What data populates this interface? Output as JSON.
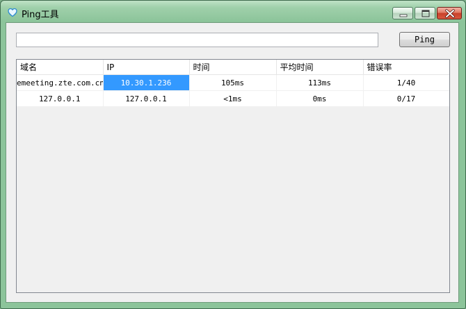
{
  "window": {
    "title": "Ping工具"
  },
  "controls": {
    "host_input_value": "",
    "ping_button_label": "Ping"
  },
  "table": {
    "headers": [
      "域名",
      "IP",
      "时间",
      "平均时间",
      "错误率"
    ],
    "rows": [
      [
        "emeeting.zte.com.cn",
        "10.30.1.236",
        "105ms",
        "113ms",
        "1/40"
      ],
      [
        "127.0.0.1",
        "127.0.0.1",
        "<1ms",
        "0ms",
        "0/17"
      ]
    ],
    "selected": {
      "row": 0,
      "col": 1
    }
  },
  "colors": {
    "selection": "#3399ff",
    "title_bar": "#9fd0aa",
    "close_button": "#c8412a"
  },
  "icons": {
    "app": "heart-shield-icon",
    "minimize": "minimize-icon",
    "maximize": "maximize-icon",
    "close": "close-icon"
  }
}
